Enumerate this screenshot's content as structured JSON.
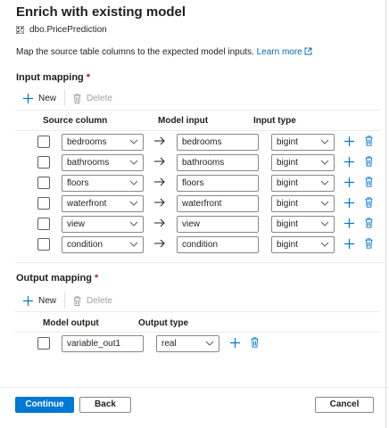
{
  "panel": {
    "title": "Enrich with existing model",
    "model_name": "dbo.PricePrediction",
    "description": "Map the source table columns to the expected model inputs.",
    "learn_more": "Learn more"
  },
  "input_mapping": {
    "title": "Input mapping",
    "required_mark": "*",
    "new_label": "New",
    "delete_label": "Delete",
    "headers": {
      "source_column": "Source column",
      "model_input": "Model input",
      "input_type": "Input type"
    },
    "rows": [
      {
        "source": "bedrooms",
        "model_input": "bedrooms",
        "type": "bigint"
      },
      {
        "source": "bathrooms",
        "model_input": "bathrooms",
        "type": "bigint"
      },
      {
        "source": "floors",
        "model_input": "floors",
        "type": "bigint"
      },
      {
        "source": "waterfront",
        "model_input": "waterfront",
        "type": "bigint"
      },
      {
        "source": "view",
        "model_input": "view",
        "type": "bigint"
      },
      {
        "source": "condition",
        "model_input": "condition",
        "type": "bigint"
      }
    ]
  },
  "output_mapping": {
    "title": "Output mapping",
    "required_mark": "*",
    "new_label": "New",
    "delete_label": "Delete",
    "headers": {
      "model_output": "Model output",
      "output_type": "Output type"
    },
    "rows": [
      {
        "model_output": "variable_out1",
        "type": "real"
      }
    ]
  },
  "footer": {
    "continue_label": "Continue",
    "back_label": "Back",
    "cancel_label": "Cancel"
  },
  "colors": {
    "accent": "#0078d4",
    "link": "#0067b8",
    "required": "#a4262c",
    "disabled": "#a19f9d"
  }
}
